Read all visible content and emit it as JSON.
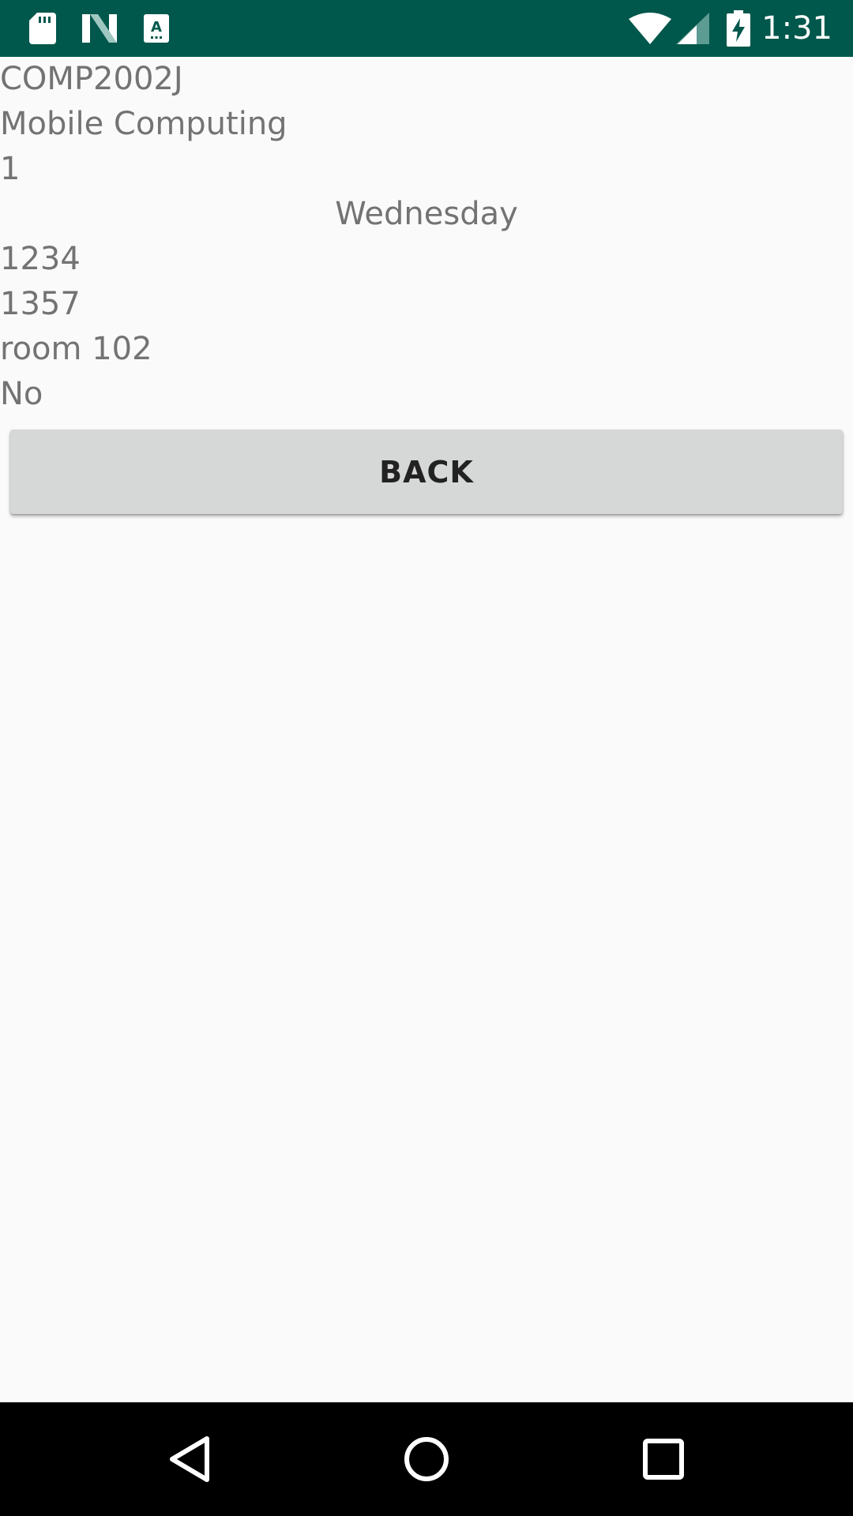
{
  "status_bar": {
    "time": "1:31",
    "left_icons": [
      "sd-card-icon",
      "n-logo-icon",
      "autofill-icon"
    ],
    "right_icons": [
      "wifi-icon",
      "signal-icon",
      "battery-charging-icon"
    ],
    "background": "#00574b"
  },
  "details": {
    "code": "COMP2002J",
    "name": "Mobile Computing",
    "number": "1",
    "day": "Wednesday",
    "start": "1234",
    "end": "1357",
    "room": "room 102",
    "flag": "No"
  },
  "back_button": {
    "label": "BACK"
  },
  "nav_bar": {
    "buttons": [
      "back-icon",
      "home-icon",
      "recents-icon"
    ]
  }
}
